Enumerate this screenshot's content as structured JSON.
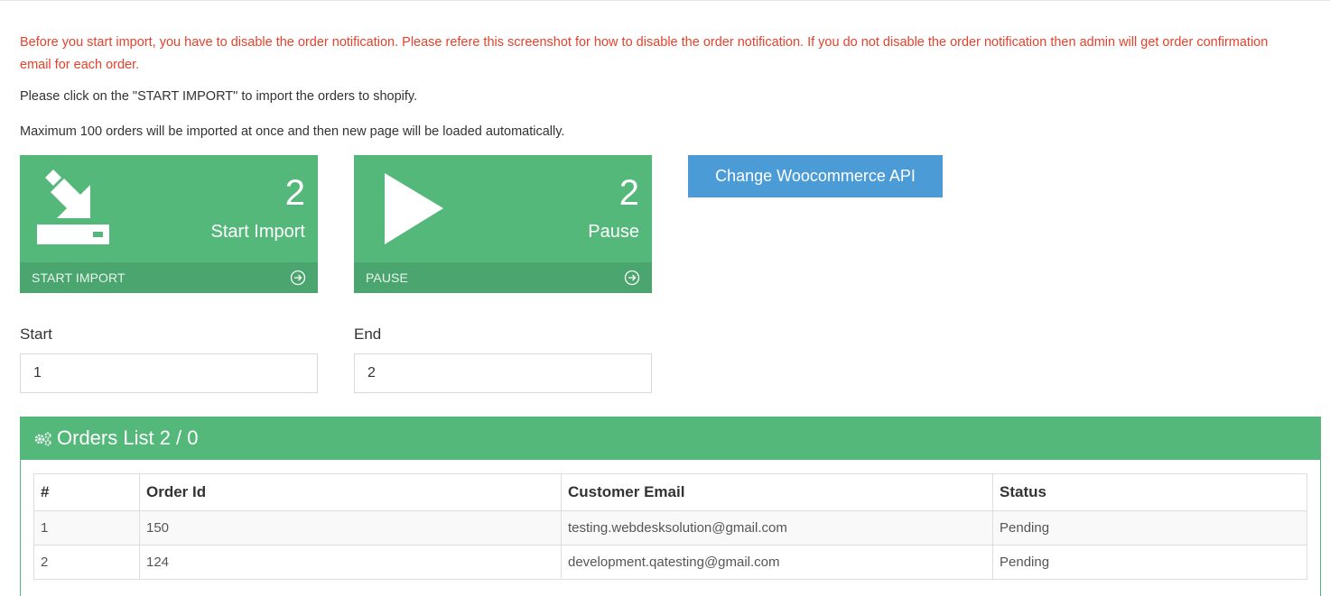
{
  "notice": "Before you start import, you have to disable the order notification. Please refere this screenshot for how to disable the order notification. If you do not disable the order notification then admin will get order confirmation email for each order.",
  "info_line_1": "Please click on the \"START IMPORT\" to import the orders to shopify.",
  "info_line_2": "Maximum 100 orders will be imported at once and then new page will be loaded automatically.",
  "tiles": {
    "start_import": {
      "count": "2",
      "label": "Start Import",
      "footer": "START IMPORT",
      "icon": "download-arrow-icon"
    },
    "pause": {
      "count": "2",
      "label": "Pause",
      "footer": "PAUSE",
      "icon": "play-icon"
    }
  },
  "api_button": "Change Woocommerce API",
  "form": {
    "start_label": "Start",
    "start_value": "1",
    "end_label": "End",
    "end_value": "2"
  },
  "orders": {
    "title": "Orders List 2 / 0",
    "columns": [
      "#",
      "Order Id",
      "Customer Email",
      "Status"
    ],
    "rows": [
      [
        "1",
        "150",
        "testing.webdesksolution@gmail.com",
        "Pending"
      ],
      [
        "2",
        "124",
        "development.qatesting@gmail.com",
        "Pending"
      ]
    ]
  },
  "colors": {
    "tile_green": "#54b87b",
    "tile_footer": "#4aa56e",
    "notice_red": "#e8402a",
    "button_blue": "#4a9bd6"
  }
}
